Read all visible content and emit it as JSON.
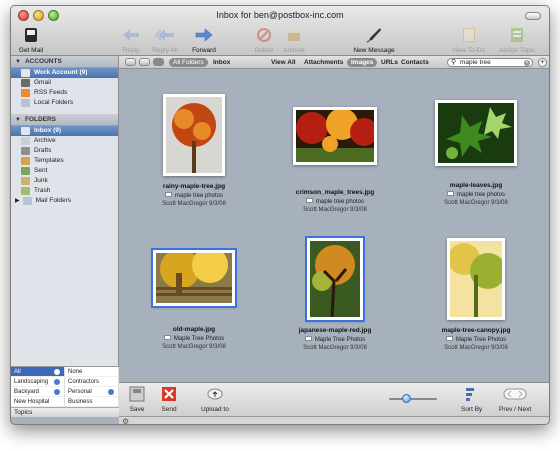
{
  "window": {
    "title": "Inbox for ben@postbox-inc.com"
  },
  "toolbar": {
    "get_mail": "Get Mail",
    "reply": "Reply",
    "reply_all": "Reply All",
    "forward": "Forward",
    "delete": "Delete",
    "archive": "Archive",
    "new_message": "New Message",
    "new_todo": "New To-Do",
    "assign_topic": "Assign Topic"
  },
  "sidebar": {
    "accounts_header": "ACCOUNTS",
    "accounts": [
      {
        "label": "Work Account (9)",
        "icon": "account-icon",
        "selected": true
      },
      {
        "label": "Gmail",
        "icon": "account-icon"
      },
      {
        "label": "RSS Feeds",
        "icon": "rss-icon"
      },
      {
        "label": "Local Folders",
        "icon": "folder-icon"
      }
    ],
    "folders_header": "FOLDERS",
    "folders": [
      {
        "label": "Inbox (9)",
        "icon": "inbox-icon",
        "selected": true
      },
      {
        "label": "Archive",
        "icon": "archive-icon"
      },
      {
        "label": "Drafts",
        "icon": "drafts-icon"
      },
      {
        "label": "Templates",
        "icon": "templates-icon"
      },
      {
        "label": "Sent",
        "icon": "sent-icon"
      },
      {
        "label": "Junk",
        "icon": "junk-icon"
      },
      {
        "label": "Trash",
        "icon": "trash-icon"
      },
      {
        "label": "Mail Folders",
        "icon": "folder-icon"
      }
    ]
  },
  "topics": {
    "rows": [
      [
        "All",
        "None"
      ],
      [
        "Landscaping",
        "Contractors"
      ],
      [
        "Backyard",
        "Personal"
      ],
      [
        "New Hospital",
        "Business"
      ]
    ],
    "footer": "Topics"
  },
  "filterbar": {
    "all_folders": "All Folders",
    "inbox": "Inbox",
    "view_all": "View All",
    "attachments": "Attachments",
    "images": "Images",
    "urls": "URLs",
    "contacts": "Contacts",
    "search_value": "maple tree"
  },
  "cards": [
    {
      "name": "rainy-maple-tree.jpg",
      "subject": "maple tree photos",
      "meta": "Scott MacGregor 9/3/08",
      "palette": [
        "#c24712",
        "#e8892a",
        "#5e3a1a",
        "#d8d6d0"
      ]
    },
    {
      "name": "crimson_maple_trees.jpg",
      "subject": "maple tree photos",
      "meta": "Scott MacGregor 9/3/08",
      "palette": [
        "#b51f12",
        "#f0a228",
        "#4a6b20",
        "#2a1a0a"
      ]
    },
    {
      "name": "maple-leaves.jpg",
      "subject": "maple tree photos",
      "meta": "Scott MacGregor 9/3/08",
      "palette": [
        "#3f8a20",
        "#a2d66a",
        "#1a3a10",
        "#6fb53a"
      ]
    },
    {
      "name": "old-maple.jpg",
      "subject": "Maple Tree Photos",
      "meta": "Scott MacGregor 9/3/08",
      "palette": [
        "#d8a520",
        "#6a4a1e",
        "#8a7a4a",
        "#f2cd45"
      ]
    },
    {
      "name": "japanese-maple-red.jpg",
      "subject": "Maple Tree Photos",
      "meta": "Scott MacGregor 9/3/08",
      "palette": [
        "#3a5a22",
        "#d08a20",
        "#2a1a0e",
        "#a7b23a"
      ]
    },
    {
      "name": "maple-tree-canopy.jpg",
      "subject": "Maple Tree Photos",
      "meta": "Scott MacGregor 9/3/08",
      "palette": [
        "#9ab030",
        "#e0c548",
        "#556a20",
        "#f4e2a0"
      ]
    }
  ],
  "bottombar": {
    "save": "Save",
    "send": "Send",
    "upload": "Upload to",
    "sort": "Sort By",
    "prevnext": "Prev / Next",
    "zoom_level": 0.35
  },
  "colors": {
    "selection": "#4a73ae",
    "highlight": "#3a72e0"
  }
}
